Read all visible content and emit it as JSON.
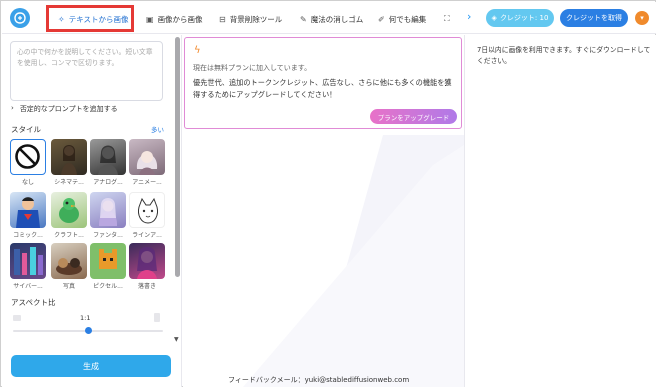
{
  "nav": {
    "items": [
      {
        "label": "テキストから画像",
        "icon": "magic-wand-icon"
      },
      {
        "label": "画像から画像",
        "icon": "image-icon"
      },
      {
        "label": "背景削除ツール",
        "icon": "eraser-icon"
      },
      {
        "label": "魔法の消しゴム",
        "icon": "brush-icon"
      },
      {
        "label": "何でも編集",
        "icon": "pen-icon"
      }
    ],
    "credit_label": "クレジット: 10",
    "get_credit_label": "クレジットを取得"
  },
  "left": {
    "prompt_placeholder": "心の中で何かを説明してください。短い文章を使用し、コンマで区切ります。",
    "negative_prompt_label": "否定的なプロンプトを追加する",
    "style_label": "スタイル",
    "more_label": "多い",
    "styles": [
      {
        "label": "なし"
      },
      {
        "label": "シネマテ..."
      },
      {
        "label": "アナログ..."
      },
      {
        "label": "アニメー..."
      },
      {
        "label": "コミック..."
      },
      {
        "label": "クラフト..."
      },
      {
        "label": "ファンタ..."
      },
      {
        "label": "ラインア..."
      },
      {
        "label": "サイバー..."
      },
      {
        "label": "写真"
      },
      {
        "label": "ピクセル..."
      },
      {
        "label": "落書き"
      }
    ],
    "aspect_label": "アスペクト比",
    "aspect_value": "1:1",
    "generate_label": "生成"
  },
  "promo": {
    "line1": "現在は無料プランに加入しています。",
    "line2": "優先世代、追加のトークンクレジット、広告なし、さらに他にも多くの機能を獲得するためにアップグレードしてください！",
    "upgrade_label": "プランをアップグレード"
  },
  "feedback": "フィードバックメール：yuki@stablediffusionweb.com",
  "right": {
    "note": "7日以内に画像を利用できます。すぐにダウンロードしてください。"
  },
  "colors": {
    "accent": "#2b7fe3",
    "highlight": "#e53935",
    "promo_border": "#e08bd6",
    "generate": "#2fa8ea",
    "bolt": "#f2892b"
  }
}
